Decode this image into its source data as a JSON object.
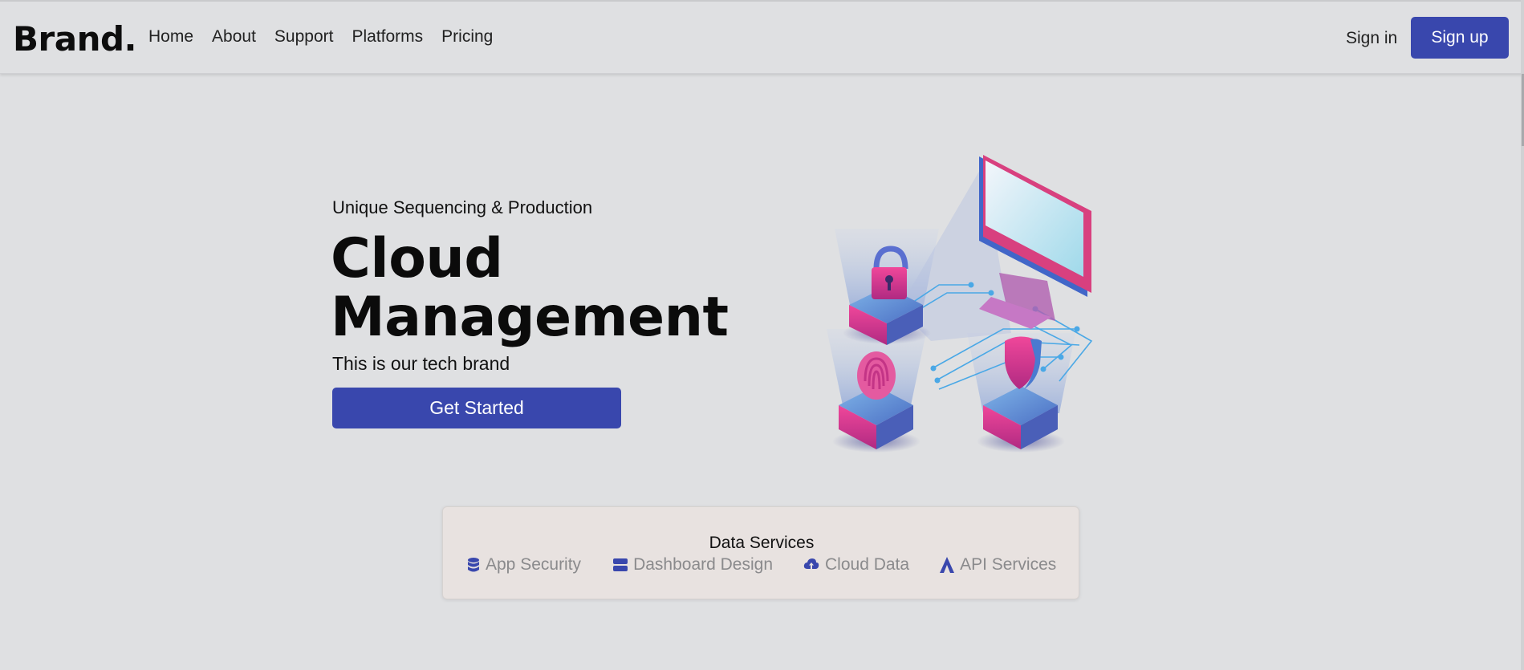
{
  "navbar": {
    "brand": "Brand.",
    "links": [
      "Home",
      "About",
      "Support",
      "Platforms",
      "Pricing"
    ],
    "sign_in": "Sign in",
    "sign_up": "Sign up"
  },
  "hero": {
    "subtitle": "Unique Sequencing & Production",
    "title_line1": "Cloud",
    "title_line2": "Management",
    "description": "This is our tech brand",
    "cta": "Get Started",
    "illustration_icons": [
      "padlock-icon",
      "fingerprint-icon",
      "shield-icon",
      "monitor-icon"
    ]
  },
  "services": {
    "title": "Data Services",
    "items": [
      {
        "label": "App Security",
        "icon": "database-icon"
      },
      {
        "label": "Dashboard Design",
        "icon": "server-icon"
      },
      {
        "label": "Cloud Data",
        "icon": "cloud-upload-icon"
      },
      {
        "label": "API Services",
        "icon": "a-letter-icon"
      }
    ]
  },
  "colors": {
    "background": "#dfe0e2",
    "accent": "#3947ad",
    "card": "#e8e2e0",
    "muted_text": "#8a8a8c"
  }
}
